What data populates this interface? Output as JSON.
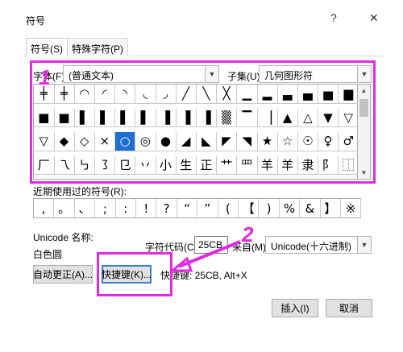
{
  "window": {
    "title": "符号",
    "help": "?",
    "close": "✕"
  },
  "tabs": [
    {
      "label": "符号(S)"
    },
    {
      "label": "特殊字符(P)"
    }
  ],
  "font": {
    "label": "字体(F):",
    "value": "(普通文本)"
  },
  "subset": {
    "label": "子集(U):",
    "value": "几何图形符"
  },
  "symbol_grid": [
    [
      "╪",
      "╪",
      "◠",
      "◜",
      "◝",
      "◟",
      "◞",
      "╱",
      "╲",
      "╳",
      "▁",
      "▂",
      "▃",
      "▄",
      "▅",
      "▆"
    ],
    [
      "■",
      "■",
      "▌",
      "▌",
      "▌",
      "▌",
      "▐",
      "▐",
      "▐",
      "▒",
      "▔",
      "▕",
      "▲",
      "△",
      "▼",
      "▽"
    ],
    [
      "▽",
      "◆",
      "◇",
      "×",
      "○",
      "◎",
      "●",
      "◢",
      "◣",
      "◤",
      "◥",
      "★",
      "☆",
      "☉",
      "♀",
      "♂"
    ],
    [
      "厂",
      "乁",
      "㇉",
      "㇌",
      "㔾",
      "丷",
      "小",
      "生",
      "正",
      "艹",
      "罒",
      "羊",
      "羊",
      "隶",
      "阝",
      "⿰"
    ]
  ],
  "selected_symbol": "○",
  "recent": {
    "label": "近期使用过的符号(R):",
    "symbols": [
      ",",
      "。",
      "、",
      ";",
      ":",
      "!",
      "?",
      "“",
      "”",
      "(",
      "【",
      ")",
      "%",
      "&",
      "】",
      "※"
    ]
  },
  "unicode_name": {
    "label": "Unicode 名称:",
    "value": "白色圆"
  },
  "char_code": {
    "label": "字符代码(C):",
    "value": "25CB"
  },
  "from": {
    "label": "来自(M):",
    "value": "Unicode(十六进制)"
  },
  "buttons": {
    "autocorrect": "自动更正(A)...",
    "shortcut": "快捷键(K)...",
    "insert": "插入(I)",
    "cancel": "取消"
  },
  "shortcut_text": "快捷键: 25CB, Alt+X",
  "annotations": {
    "num1": "1",
    "num2": "2"
  },
  "colors": {
    "highlight": "#e02be0",
    "selection": "#1e6fd0"
  }
}
